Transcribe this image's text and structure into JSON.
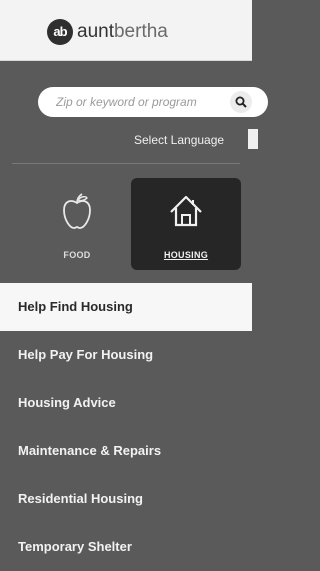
{
  "brand": {
    "badge": "ab",
    "name_bold": "aunt",
    "name_light": "bertha"
  },
  "search": {
    "placeholder": "Zip or keyword or program"
  },
  "language": {
    "label": "Select Language"
  },
  "categories": [
    {
      "label": "FOOD",
      "icon": "apple-icon",
      "selected": false
    },
    {
      "label": "HOUSING",
      "icon": "house-icon",
      "selected": true
    }
  ],
  "menu": [
    {
      "label": "Help Find Housing",
      "active": true
    },
    {
      "label": "Help Pay For Housing",
      "active": false
    },
    {
      "label": "Housing Advice",
      "active": false
    },
    {
      "label": "Maintenance & Repairs",
      "active": false
    },
    {
      "label": "Residential Housing",
      "active": false
    },
    {
      "label": "Temporary Shelter",
      "active": false
    }
  ],
  "colors": {
    "sidebar_bg": "#5a5a5a",
    "header_bg": "#f3f3f3",
    "selected_tile_bg": "#262626",
    "active_item_bg": "#f7f7f7"
  }
}
